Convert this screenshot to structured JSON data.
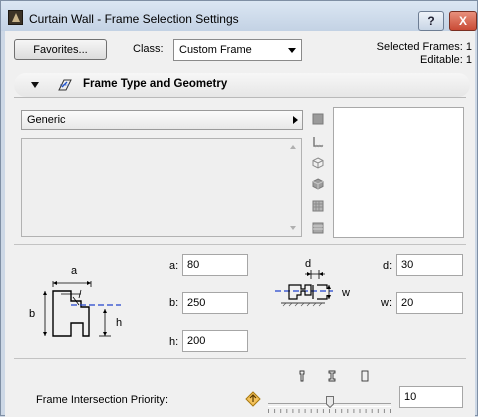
{
  "window": {
    "title": "Curtain Wall - Frame Selection Settings",
    "help_label": "?",
    "close_label": "X"
  },
  "toolbar": {
    "favorites_label": "Favorites...",
    "class_label": "Class:",
    "class_value": "Custom Frame",
    "selected_frames": "Selected Frames: 1",
    "editable": "Editable: 1"
  },
  "section": {
    "title": "Frame Type and Geometry"
  },
  "frame_type": {
    "value": "Generic"
  },
  "view_icons": [
    "plan-view-icon",
    "section-view-icon",
    "3d-wireframe-icon",
    "3d-shaded-icon",
    "hatch-pattern-icon",
    "material-icon"
  ],
  "dimensions": {
    "a_label": "a:",
    "a_value": "80",
    "b_label": "b:",
    "b_value": "250",
    "h_label": "h:",
    "h_value": "200",
    "d_label": "d:",
    "d_value": "30",
    "w_label": "w:",
    "w_value": "20",
    "diagram1": {
      "a": "a",
      "b": "b",
      "h": "h"
    },
    "diagram2": {
      "d": "d",
      "w": "w"
    }
  },
  "priority": {
    "label": "Frame Intersection Priority:",
    "value": "10",
    "slider_level": 0.5
  }
}
